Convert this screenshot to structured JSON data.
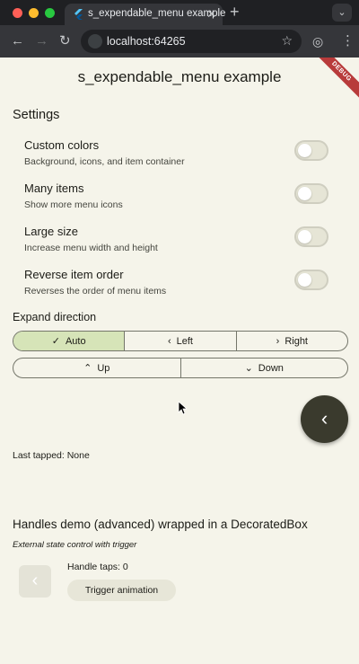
{
  "browser": {
    "tab_title": "s_expendable_menu example",
    "url": "localhost:64265",
    "colors": {
      "close": "#ff5f57",
      "minimize": "#febc2e",
      "maximize": "#28c840"
    }
  },
  "app": {
    "title": "s_expendable_menu example",
    "debug_banner": "DEBUG"
  },
  "settings": {
    "heading": "Settings",
    "items": [
      {
        "title": "Custom colors",
        "subtitle": "Background, icons, and item container",
        "on": false
      },
      {
        "title": "Many items",
        "subtitle": "Show more menu icons",
        "on": false
      },
      {
        "title": "Large size",
        "subtitle": "Increase menu width and height",
        "on": false
      },
      {
        "title": "Reverse item order",
        "subtitle": "Reverses the order of menu items",
        "on": false
      }
    ]
  },
  "expand_direction": {
    "label": "Expand direction",
    "row1": [
      {
        "label": "Auto",
        "icon": "check-icon",
        "selected": true
      },
      {
        "label": "Left",
        "icon": "chevron-left-icon",
        "selected": false
      },
      {
        "label": "Right",
        "icon": "chevron-right-icon",
        "selected": false
      }
    ],
    "row2": [
      {
        "label": "Up",
        "icon": "chevron-up-icon",
        "selected": false
      },
      {
        "label": "Down",
        "icon": "chevron-down-icon",
        "selected": false
      }
    ]
  },
  "status": {
    "last_tapped": "Last tapped: None"
  },
  "handles_demo": {
    "heading": "Handles demo (advanced) wrapped in a DecoratedBox",
    "caption": "External state control with trigger",
    "taps": "Handle taps: 0",
    "trigger_label": "Trigger animation"
  }
}
